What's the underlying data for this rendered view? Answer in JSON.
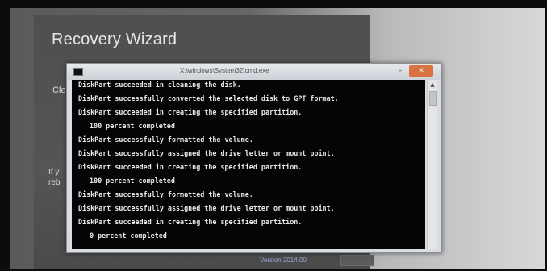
{
  "wizard": {
    "title": "Recovery Wizard",
    "text_fragment_1": "Cle",
    "text_fragment_2": "",
    "text_fragment_3": "If y",
    "text_fragment_4": "reb",
    "version": "Version 2014.00"
  },
  "cmd": {
    "title": "X:\\windows\\System32\\cmd.exe",
    "minimize_label": "–",
    "close_label": "✕",
    "lines": [
      "DiskPart succeeded in cleaning the disk.",
      "DiskPart successfully converted the selected disk to GPT format.",
      "DiskPart succeeded in creating the specified partition.",
      "100 percent completed",
      "DiskPart successfully formatted the volume.",
      "DiskPart successfully assigned the drive letter or mount point.",
      "DiskPart succeeded in creating the specified partition.",
      "100 percent completed",
      "DiskPart successfully formatted the volume.",
      "DiskPart successfully assigned the drive letter or mount point.",
      "DiskPart succeeded in creating the specified partition.",
      "0 percent completed"
    ]
  },
  "colors": {
    "console_bg": "#050505",
    "console_fg": "#e8e8e8",
    "close_button": "#d8723e",
    "wizard_panel": "#505050"
  }
}
